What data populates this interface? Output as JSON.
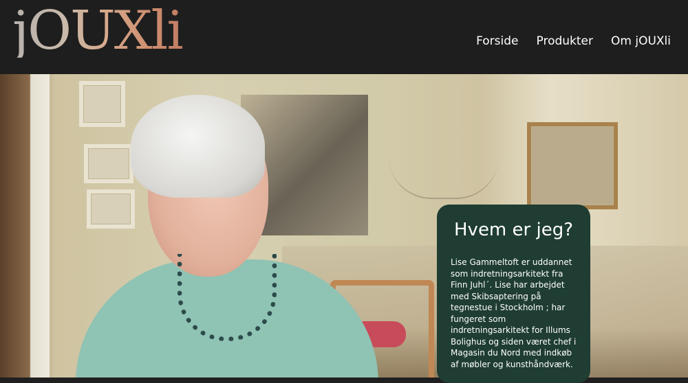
{
  "header": {
    "logo_text": "jOUXli",
    "nav": [
      {
        "label": "Forside"
      },
      {
        "label": "Produkter"
      },
      {
        "label": "Om jOUXli"
      }
    ]
  },
  "hero": {
    "image_subject": "portrait photo",
    "card": {
      "title": "Hvem er jeg?",
      "body": "Lise Gammeltoft er uddannet som indretningsarkitekt fra Finn Juhl´. Lise har arbejdet med Skibsaptering på tegnestue i Stockholm ; har fungeret som indretningsarkitekt for Illums Bolighus og siden været chef i Magasin du Nord med indkøb af møbler og kunsthåndværk."
    }
  },
  "colors": {
    "header_bg": "#1e1e1e",
    "card_bg": "#1f3d32",
    "nav_text": "#ffffff"
  }
}
